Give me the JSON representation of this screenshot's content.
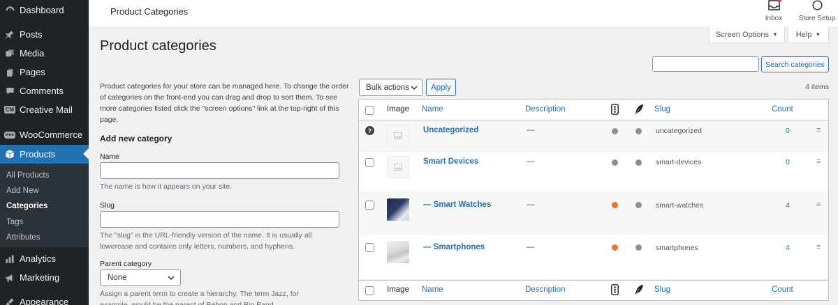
{
  "sidebar": {
    "top_items": [
      {
        "label": "Dashboard",
        "icon": "dashboard-icon"
      },
      {
        "label": "Posts",
        "icon": "pin-icon"
      },
      {
        "label": "Media",
        "icon": "media-icon"
      },
      {
        "label": "Pages",
        "icon": "pages-icon"
      },
      {
        "label": "Comments",
        "icon": "comment-icon"
      },
      {
        "label": "Creative Mail",
        "icon": "creative-mail-icon",
        "badge": "CM"
      },
      {
        "label": "WooCommerce",
        "icon": "woocommerce-icon",
        "badge": "woo"
      },
      {
        "label": "Products",
        "icon": "products-icon"
      },
      {
        "label": "Analytics",
        "icon": "analytics-icon"
      },
      {
        "label": "Marketing",
        "icon": "megaphone-icon"
      },
      {
        "label": "Appearance",
        "icon": "brush-icon"
      }
    ],
    "sub_items": [
      "All Products",
      "Add New",
      "Categories",
      "Tags",
      "Attributes"
    ]
  },
  "topbar": {
    "title": "Product Categories",
    "inbox_label": "Inbox",
    "store_setup_label": "Store Setup"
  },
  "screen_options_label": "Screen Options",
  "help_label": "Help",
  "page_title": "Product categories",
  "search": {
    "placeholder": "",
    "button_label": "Search categories"
  },
  "form": {
    "description": "Product categories for your store can be managed here. To change the order of categories on the front-end you can drag and drop to sort them. To see more categories listed click the \"screen options\" link at the top-right of this page.",
    "heading": "Add new category",
    "name_label": "Name",
    "name_value": "",
    "name_hint": "The name is how it appears on your site.",
    "slug_label": "Slug",
    "slug_value": "",
    "slug_hint": "The \"slug\" is the URL-friendly version of the name. It is usually all lowercase and contains only letters, numbers, and hyphens.",
    "parent_label": "Parent category",
    "parent_value": "None",
    "parent_hint": "Assign a parent term to create a hierarchy. The term Jazz, for example, would be the parent of Bebop and Big Band."
  },
  "bulk": {
    "select_value": "Bulk actions",
    "apply_label": "Apply",
    "items_count": "4 items"
  },
  "table": {
    "columns": {
      "image": "Image",
      "name": "Name",
      "description": "Description",
      "slug": "Slug",
      "count": "Count"
    },
    "rows": [
      {
        "name": "Uncategorized",
        "description": "—",
        "slug": "uncategorized",
        "count": "0",
        "dot1": "#8c8f94",
        "dot2": "#8c8f94",
        "help": true,
        "thumb": "placeholder"
      },
      {
        "name": "Smart Devices",
        "description": "—",
        "slug": "smart-devices",
        "count": "0",
        "dot1": "#8c8f94",
        "dot2": "#8c8f94",
        "help": false,
        "thumb": "placeholder"
      },
      {
        "name": "— Smart Watches",
        "description": "—",
        "slug": "smart-watches",
        "count": "4",
        "dot1": "#f56e28",
        "dot2": "#8c8f94",
        "help": false,
        "thumb": "watch"
      },
      {
        "name": "— Smartphones",
        "description": "—",
        "slug": "smartphones",
        "count": "4",
        "dot1": "#f56e28",
        "dot2": "#8c8f94",
        "help": false,
        "thumb": "phone"
      }
    ]
  },
  "colors": {
    "accent": "#2271b1",
    "sidebar_bg": "#1d2327",
    "orange": "#f56e28"
  }
}
